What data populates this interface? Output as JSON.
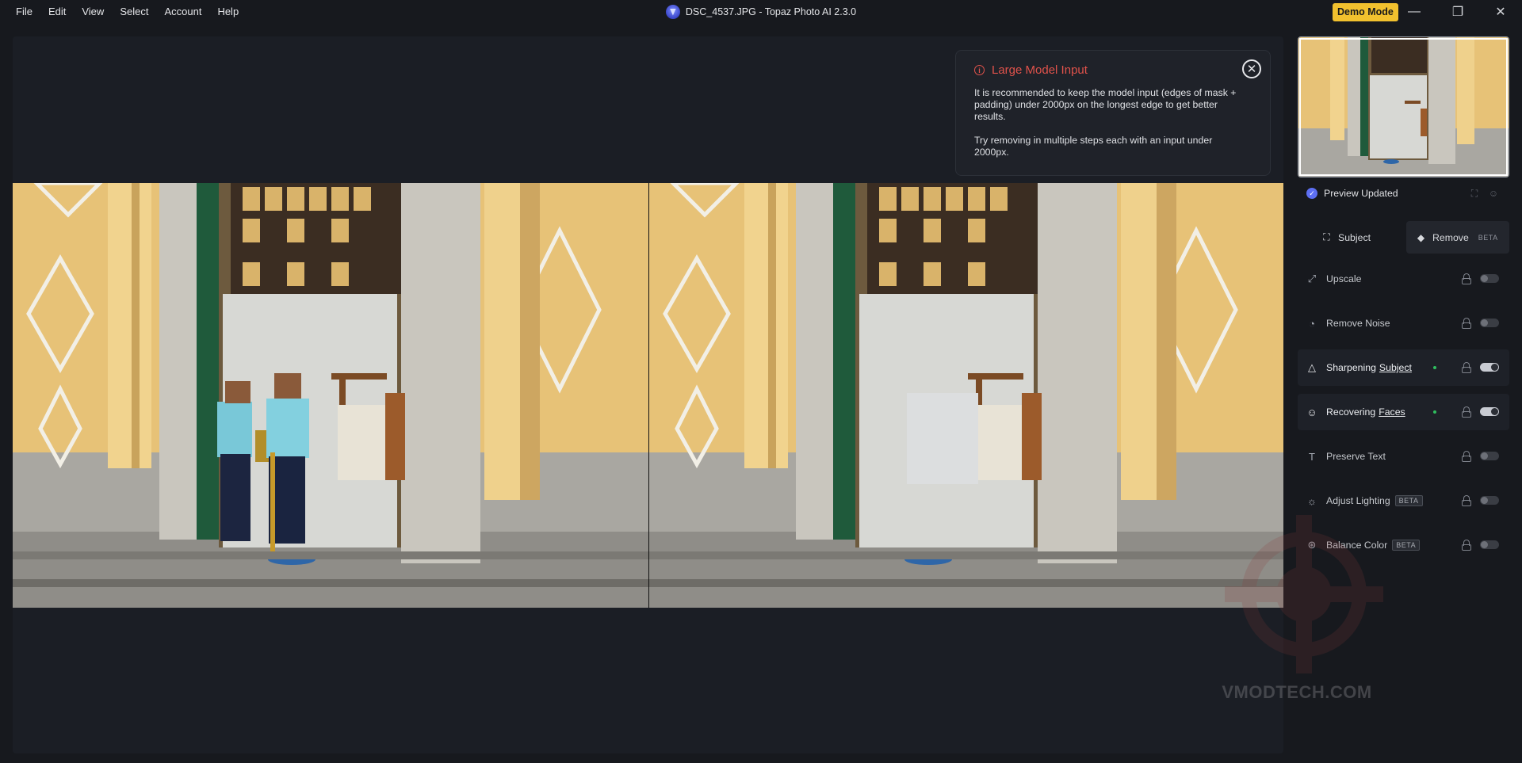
{
  "menu": [
    "File",
    "Edit",
    "View",
    "Select",
    "Account",
    "Help"
  ],
  "window_title": "DSC_4537.JPG - Topaz Photo AI 2.3.0",
  "demo_button": "Demo Mode",
  "window_controls": {
    "minimize": "—",
    "restore": "❐",
    "close": "✕"
  },
  "popup": {
    "title": "Large Model Input",
    "line1": "It is recommended to keep the model input (edges of mask + padding) under 2000px on the longest edge to get better results.",
    "line2": "Try removing in multiple steps each with an input under 2000px.",
    "close_glyph": "✕"
  },
  "status": {
    "label": "Preview Updated"
  },
  "tabs": {
    "subject": "Subject",
    "remove": "Remove",
    "remove_badge": "BETA"
  },
  "filters": [
    {
      "label": "Upscale",
      "icon": "upscale-icon",
      "enabled": false
    },
    {
      "label": "Remove Noise",
      "icon": "noise-icon",
      "enabled": false
    },
    {
      "label": "Sharpening",
      "link": "Subject",
      "icon": "sharpen-icon",
      "enabled": true
    },
    {
      "label": "Recovering",
      "link": "Faces",
      "icon": "face-icon",
      "enabled": true
    },
    {
      "label": "Preserve Text",
      "icon": "text-icon",
      "enabled": false
    },
    {
      "label": "Adjust Lighting",
      "badge": "BETA",
      "icon": "lighting-icon",
      "enabled": false
    },
    {
      "label": "Balance Color",
      "badge": "BETA",
      "icon": "color-icon",
      "enabled": false
    }
  ],
  "watermark": "VMODTECH.COM",
  "colors": {
    "accent": "#5d6ff2",
    "warning": "#e0524b",
    "demo": "#f2c12e",
    "active_dot": "#2fbf5f"
  }
}
